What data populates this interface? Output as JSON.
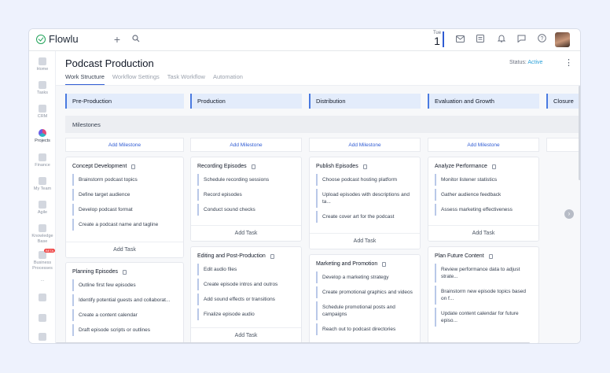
{
  "app": {
    "name": "Flowlu"
  },
  "topbar": {
    "date_dow": "Tue",
    "date_day": "1"
  },
  "sidebar": {
    "items": [
      {
        "label": "Home"
      },
      {
        "label": "Tasks"
      },
      {
        "label": "CRM"
      },
      {
        "label": "Projects"
      },
      {
        "label": "Finance"
      },
      {
        "label": "My Team"
      },
      {
        "label": "Agile"
      },
      {
        "label": "Knowledge Base"
      },
      {
        "label": "Business Processes"
      }
    ],
    "beta_badge": "BETA",
    "more": "..."
  },
  "project": {
    "title": "Podcast Production",
    "status_label": "Status:",
    "status_value": "Active"
  },
  "tabs": [
    {
      "label": "Work Structure"
    },
    {
      "label": "Workflow Settings"
    },
    {
      "label": "Task Workflow"
    },
    {
      "label": "Automation"
    }
  ],
  "stages": [
    {
      "label": "Pre-Production"
    },
    {
      "label": "Production"
    },
    {
      "label": "Distribution"
    },
    {
      "label": "Evaluation and Growth"
    },
    {
      "label": "Closure"
    }
  ],
  "milestones": {
    "label": "Milestones",
    "add_label": "Add Milestone"
  },
  "add_task_label": "Add Task",
  "columns": [
    {
      "cards": [
        {
          "title": "Concept Development",
          "tasks": [
            "Brainstorm podcast topics",
            "Define target audience",
            "Develop podcast format",
            "Create a podcast name and tagline"
          ]
        },
        {
          "title": "Planning Episodes",
          "tasks": [
            "Outline first few episodes",
            "Identify potential guests and collaborat...",
            "Create a content calendar",
            "Draft episode scripts or outlines"
          ]
        }
      ]
    },
    {
      "cards": [
        {
          "title": "Recording Episodes",
          "tasks": [
            "Schedule recording sessions",
            "Record episodes",
            "Conduct sound checks"
          ]
        },
        {
          "title": "Editing and Post-Production",
          "tasks": [
            "Edit audio files",
            "Create episode intros and outros",
            "Add sound effects or transitions",
            "Finalize episode audio"
          ]
        }
      ]
    },
    {
      "cards": [
        {
          "title": "Publish Episodes",
          "tasks": [
            "Choose podcast hosting platform",
            "Upload episodes with descriptions and ta...",
            "Create cover art for the podcast"
          ]
        },
        {
          "title": "Marketing and Promotion",
          "tasks": [
            "Develop a marketing strategy",
            "Create promotional graphics and videos",
            "Schedule promotional posts and campaigns",
            "Reach out to podcast directories"
          ]
        }
      ]
    },
    {
      "cards": [
        {
          "title": "Analyze Performance",
          "tasks": [
            "Monitor listener statistics",
            "Gather audience feedback",
            "Assess marketing effectiveness"
          ]
        },
        {
          "title": "Plan Future Content",
          "tasks": [
            "Review performance data to adjust strate...",
            "Brainstorm new episode topics based on f...",
            "Update content calendar for future episo..."
          ]
        }
      ]
    }
  ],
  "scroll_right": "›"
}
